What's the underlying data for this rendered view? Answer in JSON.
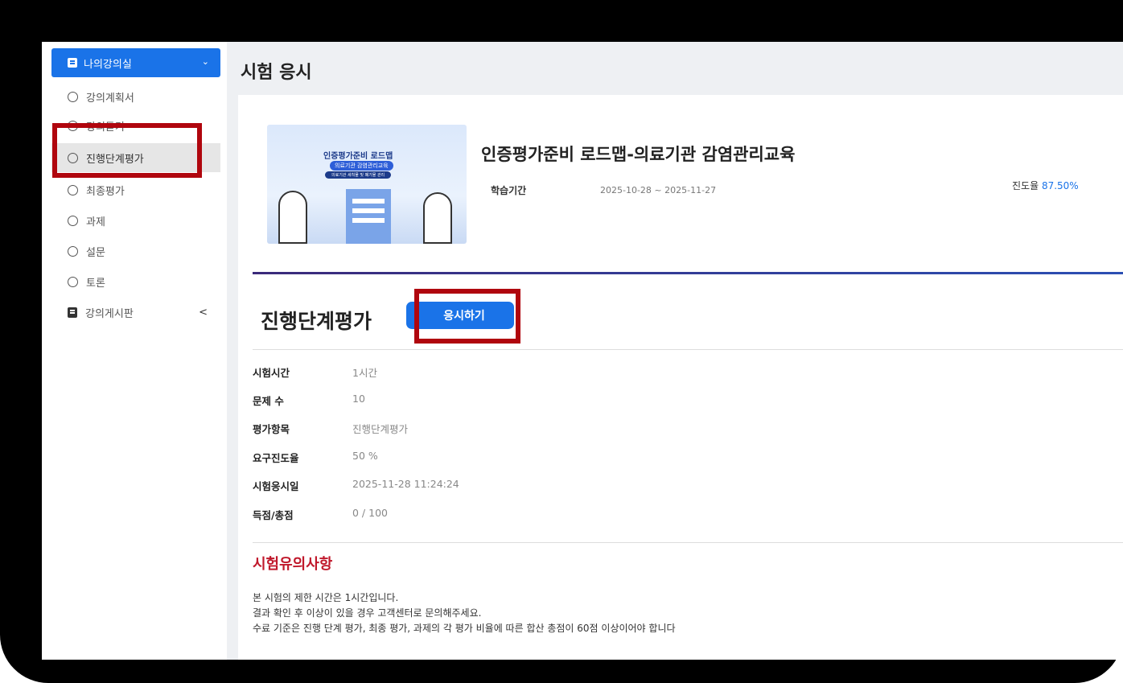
{
  "sidebar": {
    "header": {
      "label": "나의강의실",
      "icon": "book-icon",
      "chevron": "⌄"
    },
    "items": [
      {
        "label": "강의계획서"
      },
      {
        "label": "강의듣기"
      },
      {
        "label": "진행단계평가"
      },
      {
        "label": "최종평가"
      },
      {
        "label": "과제"
      },
      {
        "label": "설문"
      },
      {
        "label": "토론"
      }
    ],
    "board": {
      "label": "강의게시판",
      "icon": "board-icon",
      "chevron": "<"
    }
  },
  "page": {
    "title": "시험 응시"
  },
  "course": {
    "thumbnail": {
      "title": "인증평가준비 로드맵",
      "subtitle": "의료기관 감염관리교육",
      "caption": "의료기관 세척물 및 폐기물 관리"
    },
    "title": "인증평가준비 로드맵-의료기관 감염관리교육",
    "study_period_label": "학습기간",
    "study_period_value": "2025-10-28 ~ 2025-11-27",
    "progress_label": "진도율",
    "progress_value": "87.50%"
  },
  "exam": {
    "title": "진행단계평가",
    "apply_label": "응시하기",
    "info": [
      {
        "key": "시험시간",
        "value": "1시간"
      },
      {
        "key": "문제 수",
        "value": "10"
      },
      {
        "key": "평가항목",
        "value": "진행단계평가"
      },
      {
        "key": "요구진도율",
        "value": "50 %"
      },
      {
        "key": "시험응시일",
        "value": "2025-11-28 11:24:24"
      },
      {
        "key": "득점/총점",
        "value": "0 / 100"
      }
    ]
  },
  "notice": {
    "title": "시험유의사항",
    "lines": [
      "본 시험의 제한 시간은 1시간입니다.",
      "결과 확인 후 이상이 있을 경우 고객센터로 문의해주세요.",
      "수료 기준은 진행 단계 평가, 최종 평가, 과제의 각 평가 비율에 따른 합산 총점이 60점 이상이어야 합니다"
    ]
  },
  "colors": {
    "accent": "#1a73e8",
    "highlight": "#b0060e",
    "notice": "#c0182b"
  }
}
